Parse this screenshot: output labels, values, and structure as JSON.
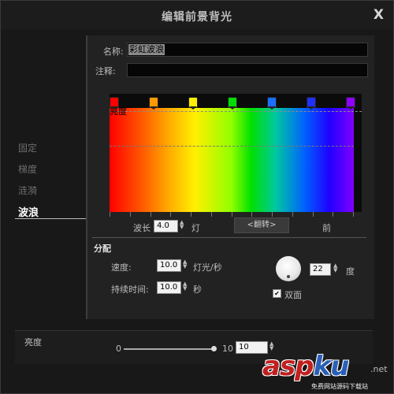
{
  "window": {
    "title": "编辑前景背光",
    "close_label": "X"
  },
  "sidebar": {
    "items": [
      {
        "label": "固定"
      },
      {
        "label": "梯度"
      },
      {
        "label": "涟漪"
      },
      {
        "label": "波浪",
        "active": true
      }
    ]
  },
  "form": {
    "name_label": "名称:",
    "name_value": "彩虹波浪",
    "note_label": "注释:",
    "note_value": ""
  },
  "gradient": {
    "label": "亮度",
    "stops": [
      {
        "color": "#ff0000"
      },
      {
        "color": "#ff9900"
      },
      {
        "color": "#ffee00"
      },
      {
        "color": "#00dd00"
      },
      {
        "color": "#1a6fff"
      },
      {
        "color": "#2030ff"
      },
      {
        "color": "#9000ff"
      }
    ]
  },
  "controls": {
    "wavelength_label": "波长",
    "wavelength_value": "4.0",
    "wavelength_unit": "灯",
    "flip_label": "<翻转>",
    "direction_label": "前"
  },
  "distribution": {
    "heading": "分配",
    "speed_label": "速度:",
    "speed_value": "10.0",
    "speed_unit": "灯光/秒",
    "duration_label": "持续时间:",
    "duration_value": "10.0",
    "duration_unit": "秒",
    "angle_value": "22",
    "angle_unit": "度",
    "double_label": "双面",
    "double_checked": true
  },
  "brightness": {
    "label": "亮度",
    "min_label": "0",
    "max_label": "10",
    "value": "10",
    "level": 1.0
  },
  "watermark": {
    "text_red1": "asp",
    "text_blue": "ku",
    "text_suffix": ".net",
    "subtitle": "免费网站源码下载站"
  }
}
